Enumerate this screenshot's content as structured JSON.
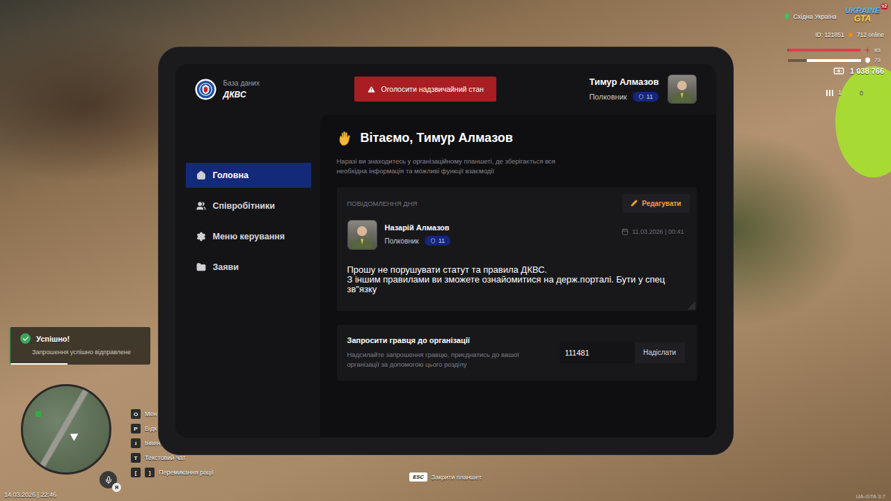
{
  "hud": {
    "region": "Східна Україна",
    "logo": {
      "line1": "UKRAINE",
      "line2": "GTA",
      "badge": "x2"
    },
    "id": "ID: 121851",
    "online": "712 online",
    "health": {
      "value": "83",
      "level": 0.98
    },
    "armor": {
      "value": "73",
      "level": 0.74
    },
    "money": "1 038 766",
    "ammo": {
      "clip": "1",
      "total": "0"
    }
  },
  "notification": {
    "title": "Успішно!",
    "text": "Запрошення успішно відправлене",
    "level": 0.41
  },
  "minimap": {
    "mic_label": "Я"
  },
  "key_hints": [
    {
      "keys": [
        "O"
      ],
      "label": "Мен"
    },
    {
      "keys": [
        "P"
      ],
      "label": "Відк"
    },
    {
      "keys": [
        "I"
      ],
      "label": "Інвент"
    },
    {
      "keys": [
        "T"
      ],
      "label": "Текстовий чат"
    },
    {
      "keys": [
        "[",
        "]"
      ],
      "label": "Перемикання рації"
    }
  ],
  "clock": "14.03.2026 | 22:46",
  "version": "UA-GTA 3.7",
  "close_hint": {
    "key": "ESC",
    "label": "Закрити планшет"
  },
  "tablet": {
    "brand": {
      "caption": "База даних",
      "title": "ДКВС"
    },
    "emergency_button": "Оголосити надзвичайний стан",
    "user": {
      "name": "Тимур Алмазов",
      "rank": "Полковник",
      "level": "11"
    },
    "sidebar": {
      "items": [
        {
          "label": "Головна",
          "selected": true
        },
        {
          "label": "Співробітники",
          "selected": false
        },
        {
          "label": "Меню керування",
          "selected": false
        },
        {
          "label": "Заяви",
          "selected": false
        }
      ]
    },
    "greeting": {
      "title": "Вітаємо, Тимур Алмазов",
      "subtitle": "Наразі ви знаходитесь у організаційному планшеті, де зберігається вся необхідна інформація та можливі функції взаємодії"
    },
    "message_of_day": {
      "label": "ПОВІДОМЛЕННЯ ДНЯ",
      "edit_button": "Редагувати",
      "author": {
        "name": "Назарій Алмазов",
        "rank": "Полковник",
        "level": "11"
      },
      "date": "11.03.2026 | 00:41",
      "text": "Прошу не порушувати статут та правила ДКВС.\nЗ іншим правилами ви зможете ознайомитися на держ.порталі. Бути у спец зв\"язку"
    },
    "invite": {
      "title": "Запросити гравця до організації",
      "description": "Надсилайте запрошення гравцю, приєднатись до вашої організації за допомогою цього розділу",
      "input_value": "111481",
      "button": "Надіслати"
    }
  }
}
